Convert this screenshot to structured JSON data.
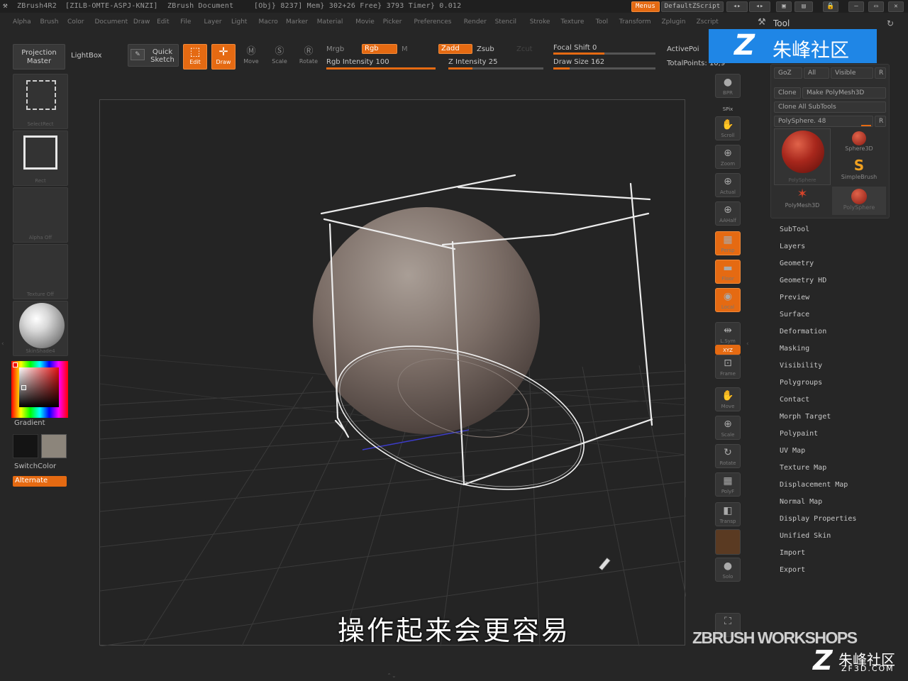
{
  "titlebar": {
    "app": "ZBrush4R2",
    "serial": "[ZILB-OMTE-ASPJ-KNZI]",
    "document": "ZBrush Document",
    "stats": "[Obj} 8237] Mem} 302+26 Free} 3793 Timer} 0.012",
    "menus_btn": "Menus",
    "script_btn": "DefaultZScript"
  },
  "menubar": [
    "Alpha",
    "Brush",
    "Color",
    "Document",
    "Draw",
    "Edit",
    "File",
    "Layer",
    "Light",
    "Macro",
    "Marker",
    "Material",
    "Movie",
    "Picker",
    "Preferences",
    "Render",
    "Stencil",
    "Stroke",
    "Texture",
    "Tool",
    "Transform",
    "Zplugin",
    "Zscript"
  ],
  "toolbar": {
    "projection_master": "Projection Master",
    "lightbox": "LightBox",
    "quick_sketch": "Quick Sketch",
    "edit": "Edit",
    "draw": "Draw",
    "move": "Move",
    "scale": "Scale",
    "rotate": "Rotate",
    "mrgb": "Mrgb",
    "rgb": "Rgb",
    "m": "M",
    "rgb_intensity": "Rgb Intensity 100",
    "zadd": "Zadd",
    "zsub": "Zsub",
    "zcut": "Zcut",
    "z_intensity": "Z Intensity 25",
    "focal_shift": "Focal Shift 0",
    "draw_size": "Draw Size 162",
    "active_points": "ActivePoi",
    "total_points": "TotalPoints: 10,9",
    "rgb_intensity_value": 1.0,
    "z_intensity_value": 0.25,
    "focal_value": 0.5,
    "drawsize_value": 0.16
  },
  "left_shelf": {
    "thumb1": "SelectRect",
    "thumb2": "Rect",
    "thumb3": "Alpha Off",
    "thumb4": "Texture Off",
    "thumb5": "SkinShade4",
    "gradient": "Gradient",
    "switchcolor": "SwitchColor",
    "alternate": "Alternate",
    "main_color": "#8c857b",
    "secondary_color": "#141414"
  },
  "right_shelf": [
    {
      "name": "bpr-button",
      "label": "BPR",
      "icon": "●"
    },
    {
      "name": "spix-button",
      "label": "SPix",
      "icon": ""
    },
    {
      "name": "scroll-button",
      "label": "Scroll",
      "icon": "✋"
    },
    {
      "name": "zoom-button",
      "label": "Zoom",
      "icon": "⊕"
    },
    {
      "name": "actual-button",
      "label": "Actual",
      "icon": "⊕"
    },
    {
      "name": "aahalf-button",
      "label": "AAHalf",
      "icon": "⊕"
    },
    {
      "name": "persp-button",
      "label": "Persp",
      "icon": "▦"
    },
    {
      "name": "floor-button",
      "label": "Floor",
      "icon": "▬"
    },
    {
      "name": "local-button",
      "label": "Local",
      "icon": "◉"
    },
    {
      "name": "lsym-button",
      "label": "L.Sym",
      "icon": "⇹"
    },
    {
      "name": "xyz-button",
      "label": "XYZ",
      "icon": ""
    },
    {
      "name": "frame-button",
      "label": "Frame",
      "icon": "⊡"
    },
    {
      "name": "move-view-button",
      "label": "Move",
      "icon": "✋"
    },
    {
      "name": "scale-view-button",
      "label": "Scale",
      "icon": "⊕"
    },
    {
      "name": "rotate-view-button",
      "label": "Rotate",
      "icon": "↻"
    },
    {
      "name": "polyf-button",
      "label": "PolyF",
      "icon": "▦"
    },
    {
      "name": "transp-button",
      "label": "Transp",
      "icon": "◧"
    },
    {
      "name": "ghost-button",
      "label": "",
      "icon": ""
    },
    {
      "name": "solo-button",
      "label": "Solo",
      "icon": "●"
    },
    {
      "name": "xpose-button",
      "label": "",
      "icon": "⛶"
    }
  ],
  "tool_panel": {
    "title": "Tool",
    "goz": "GoZ",
    "all": "All",
    "visible": "Visible",
    "r": "R",
    "clone": "Clone",
    "make_polymesh": "Make PolyMesh3D",
    "clone_all": "Clone All SubTools",
    "current_tool": "PolySphere. 48",
    "tools": [
      "Sphere3D",
      "SimpleBrush",
      "PolyMesh3D",
      "PolySphere"
    ],
    "main_tool_caption": "PolySphere"
  },
  "tool_menu": [
    "SubTool",
    "Layers",
    "Geometry",
    "Geometry HD",
    "Preview",
    "Surface",
    "Deformation",
    "Masking",
    "Visibility",
    "Polygroups",
    "Contact",
    "Morph Target",
    "Polypaint",
    "UV Map",
    "Texture Map",
    "Displacement Map",
    "Normal Map",
    "Display Properties",
    "Unified Skin",
    "Import",
    "Export"
  ],
  "subtitle": "操作起来会更容易",
  "watermark_top": "朱峰社区",
  "watermark_bottom": "朱峰社区",
  "watermark_url": "ZF3D.COM",
  "workshop_brand": "ZBRUSH WORKSHOPS"
}
